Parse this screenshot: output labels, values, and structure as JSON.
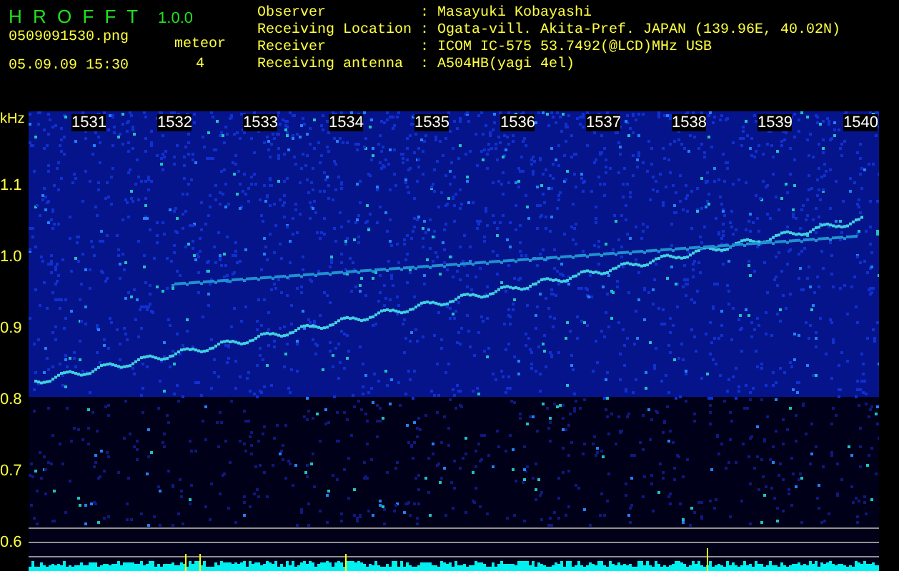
{
  "app": {
    "name": "H R O F F T",
    "version": "1.0.0"
  },
  "file": {
    "filename": "0509091530.png",
    "timestamp": "05.09.09 15:30"
  },
  "meteor": {
    "label": "meteor",
    "count": "4"
  },
  "station_info": [
    {
      "label": "Observer",
      "separator": ":",
      "value": "Masayuki Kobayashi"
    },
    {
      "label": "Receiving Location",
      "separator": ":",
      "value": "Ogata-vill. Akita-Pref. JAPAN (139.96E, 40.02N)"
    },
    {
      "label": "Receiver",
      "separator": ":",
      "value": "ICOM IC-575 53.7492(@LCD)MHz USB"
    },
    {
      "label": "Receiving antenna",
      "separator": ":",
      "value": "A504HB(yagi 4el)"
    }
  ],
  "spectrogram": {
    "unit": "kHz",
    "time_labels": [
      "1531",
      "1532",
      "1533",
      "1534",
      "1535",
      "1536",
      "1537",
      "1538",
      "1539",
      "1540"
    ],
    "frequency_labels": [
      "1.1",
      "1.0",
      "0.9",
      "0.8",
      "0.7",
      "0.6"
    ]
  }
}
